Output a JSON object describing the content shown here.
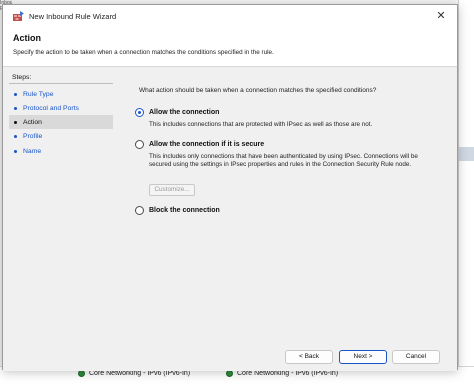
{
  "window": {
    "title": "New Inbound Rule Wizard",
    "close_glyph": "✕"
  },
  "header": {
    "title": "Action",
    "description": "Specify the action to be taken when a connection matches the conditions specified in the rule."
  },
  "steps": {
    "title": "Steps:",
    "items": [
      {
        "label": "Rule Type",
        "active": false
      },
      {
        "label": "Protocol and Ports",
        "active": false
      },
      {
        "label": "Action",
        "active": true
      },
      {
        "label": "Profile",
        "active": false
      },
      {
        "label": "Name",
        "active": false
      }
    ]
  },
  "content": {
    "question": "What action should be taken when a connection matches the specified conditions?",
    "options": [
      {
        "label": "Allow the connection",
        "selected": true,
        "description": "This includes connections that are protected with IPsec as well as those are not."
      },
      {
        "label": "Allow the connection if it is secure",
        "selected": false,
        "description": "This includes only connections that have been authenticated by using IPsec.  Connections will be secured using the settings in IPsec properties and rules in the Connection Security Rule node."
      },
      {
        "label": "Block the connection",
        "selected": false,
        "description": ""
      }
    ],
    "customize_label": "Customize..."
  },
  "buttons": {
    "back": "< Back",
    "next": "Next >",
    "cancel": "Cancel"
  },
  "background": {
    "top_left_text": "Inbound Rules",
    "rows": [
      {
        "label": "Core Networking - IPv6 (IPv6-In)"
      },
      {
        "label": "Core Networking - IPv6 (IPv6-In)"
      }
    ]
  },
  "colors": {
    "accent": "#1a55c8",
    "status_enabled": "#2e8b3a"
  },
  "icons": {
    "app": "firewall-wizard-icon",
    "close": "close-icon",
    "step_bullet": "bullet-icon",
    "row_status": "enabled-check-icon"
  }
}
